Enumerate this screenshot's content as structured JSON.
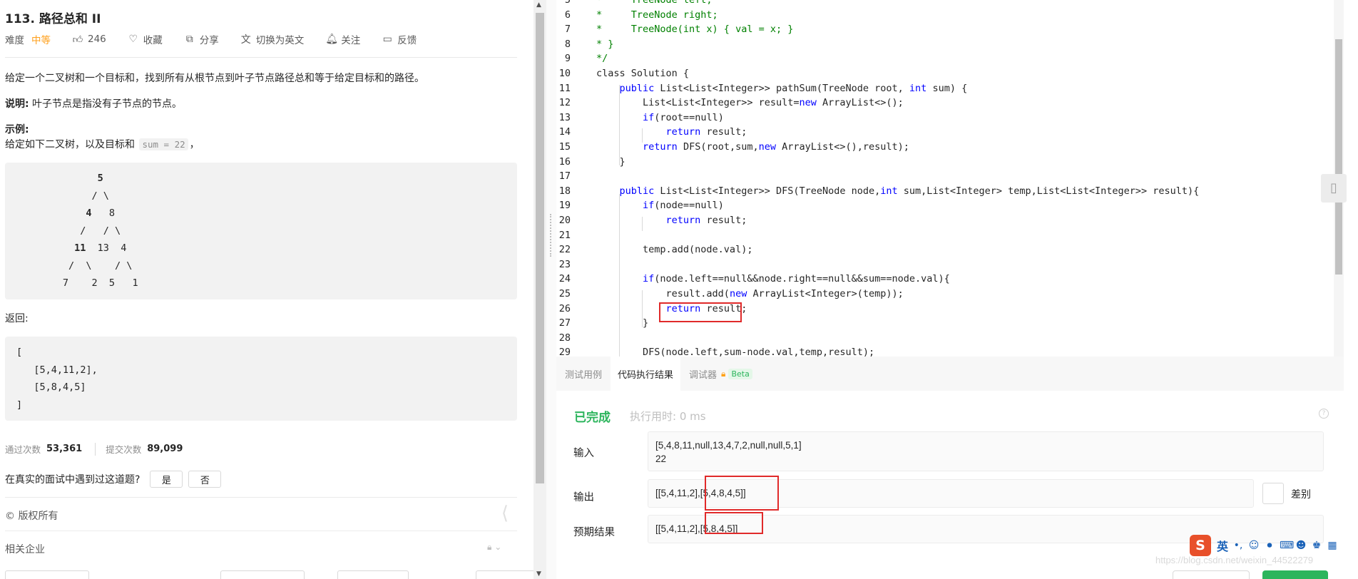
{
  "problem": {
    "title": "113. 路径总和 II",
    "difficulty_label": "难度",
    "difficulty": "中等",
    "likes": "246",
    "favorite": "收藏",
    "share": "分享",
    "switch_lang": "切换为英文",
    "follow": "关注",
    "feedback": "反馈",
    "desc": "给定一个二叉树和一个目标和，找到所有从根节点到叶子节点路径总和等于给定目标和的路径。",
    "note_label": "说明:",
    "note_text": " 叶子节点是指没有子节点的节点。",
    "example_label": "示例:",
    "example_text": "给定如下二叉树，以及目标和 ",
    "example_code": "sum = 22",
    "example_end": "，",
    "tree_lines": [
      {
        "indent": "             ",
        "bold": "5",
        "rest": ""
      },
      {
        "indent": "            ",
        "bold": "",
        "rest": "/ \\"
      },
      {
        "indent": "           ",
        "bold": "4",
        "rest": "   8"
      },
      {
        "indent": "          ",
        "bold": "",
        "rest": "/   / \\"
      },
      {
        "indent": "         ",
        "bold": "11",
        "rest": "  13  4"
      },
      {
        "indent": "        ",
        "bold": "",
        "rest": "/  \\    / \\"
      },
      {
        "indent": "       ",
        "bold": "",
        "rest": "7    2  5   1"
      }
    ],
    "return_label": "返回:",
    "return_lines": [
      "[",
      "   [5,4,11,2],",
      "   [5,8,4,5]",
      "]"
    ],
    "accepted_label": "通过次数",
    "accepted": "53,361",
    "submissions_label": "提交次数",
    "submissions": "89,099",
    "interview_q": "在真实的面试中遇到过这道题?",
    "yes": "是",
    "no": "否",
    "copyright": "© 版权所有",
    "companies": "相关企业"
  },
  "editor": {
    "lines": [
      {
        "n": "5",
        "t": "*     TreeNode left;",
        "comment": true
      },
      {
        "n": "6",
        "t": "*     TreeNode right;",
        "comment": true
      },
      {
        "n": "7",
        "t": "*     TreeNode(int x) { val = x; }",
        "comment": true
      },
      {
        "n": "8",
        "t": "* }",
        "comment": true
      },
      {
        "n": "9",
        "t": "*/",
        "comment": true
      },
      {
        "n": "10",
        "t": "class Solution {"
      },
      {
        "n": "11",
        "t": "    public List<List<Integer>> pathSum(TreeNode root, int sum) {"
      },
      {
        "n": "12",
        "t": "        List<List<Integer>> result=new ArrayList<>();"
      },
      {
        "n": "13",
        "t": "        if(root==null)"
      },
      {
        "n": "14",
        "t": "            return result;"
      },
      {
        "n": "15",
        "t": "        return DFS(root,sum,new ArrayList<>(),result);"
      },
      {
        "n": "16",
        "t": "    }"
      },
      {
        "n": "17",
        "t": ""
      },
      {
        "n": "18",
        "t": "    public List<List<Integer>> DFS(TreeNode node,int sum,List<Integer> temp,List<List<Integer>> result){"
      },
      {
        "n": "19",
        "t": "        if(node==null)"
      },
      {
        "n": "20",
        "t": "            return result;"
      },
      {
        "n": "21",
        "t": ""
      },
      {
        "n": "22",
        "t": "        temp.add(node.val);"
      },
      {
        "n": "23",
        "t": ""
      },
      {
        "n": "24",
        "t": "        if(node.left==null&&node.right==null&&sum==node.val){"
      },
      {
        "n": "25",
        "t": "            result.add(new ArrayList<Integer>(temp));"
      },
      {
        "n": "26",
        "t": "            return result;"
      },
      {
        "n": "27",
        "t": "        }"
      },
      {
        "n": "28",
        "t": ""
      },
      {
        "n": "29",
        "t": "        DFS(node.left,sum-node.val,temp,result);"
      }
    ]
  },
  "result": {
    "tabs": [
      "测试用例",
      "代码执行结果",
      "调试器"
    ],
    "beta": "Beta",
    "status": "已完成",
    "exec_time": "执行用时: 0 ms",
    "input_label": "输入",
    "input_lines": [
      "[5,4,8,11,null,13,4,7,2,null,null,5,1]",
      "22"
    ],
    "output_label": "输出",
    "output_a": "[[5,4,11,2],",
    "output_b": "[5,4,8,4,5]]",
    "expected_label": "预期结果",
    "expected_a": "[[5,4,11,2],",
    "expected_b": "[5,8,4,5]]",
    "diff": "差别"
  },
  "ime": {
    "logo": "S",
    "lang": "英"
  },
  "watermark": "https://blog.csdn.net/weixin_44522279",
  "colors": {
    "accent_green": "#2db55d",
    "difficulty": "#ff9f1a",
    "highlight_red": "#e02a2a",
    "keyword_blue": "#0000ff",
    "comment_green": "#008000"
  }
}
